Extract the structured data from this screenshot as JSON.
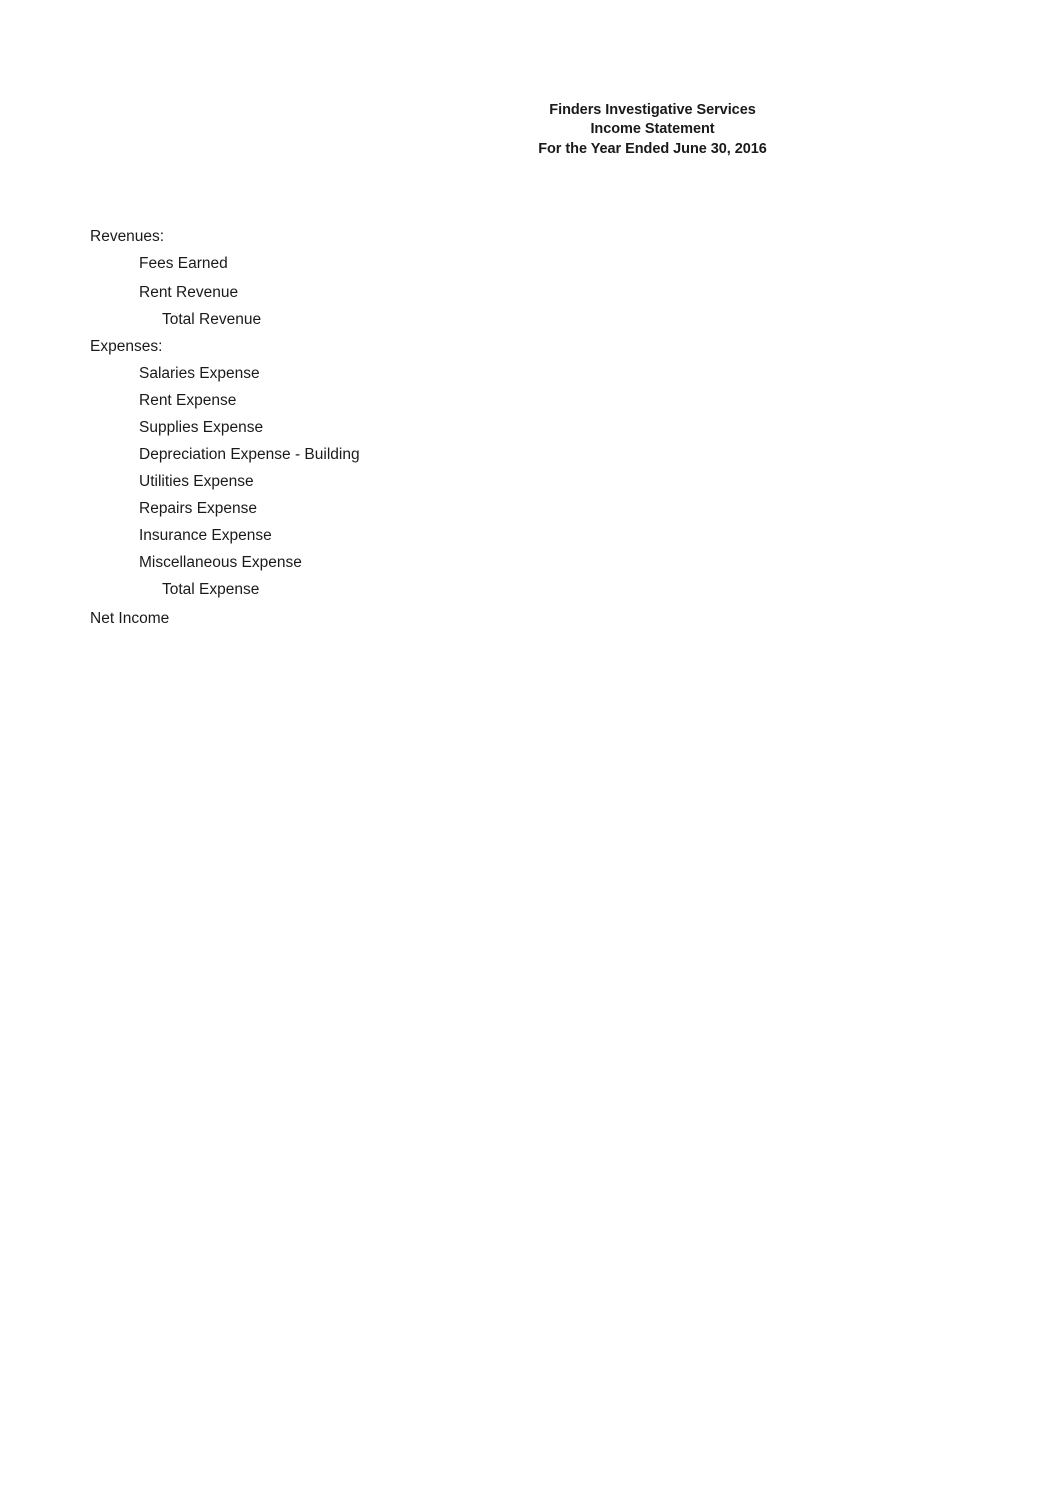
{
  "document": {
    "type": "income-statement-worksheet",
    "background_color": "#ffffff",
    "text_color": "#1a1a1a"
  },
  "header": {
    "company_name": "Finders Investigative Services",
    "statement_title": "Income Statement",
    "period": "For the Year Ended June 30, 2016"
  },
  "body": {
    "rows": [
      {
        "label": "Revenues:",
        "indent": 0,
        "spacing": "normal"
      },
      {
        "label": "Fees Earned",
        "indent": 1,
        "spacing": "large"
      },
      {
        "label": "Rent Revenue",
        "indent": 1,
        "spacing": "normal"
      },
      {
        "label": "Total Revenue",
        "indent": 2,
        "spacing": "normal"
      },
      {
        "label": "Expenses:",
        "indent": 0,
        "spacing": "normal"
      },
      {
        "label": "Salaries Expense",
        "indent": 1,
        "spacing": "normal"
      },
      {
        "label": "Rent Expense",
        "indent": 1,
        "spacing": "normal"
      },
      {
        "label": "Supplies Expense",
        "indent": 1,
        "spacing": "normal"
      },
      {
        "label": "Depreciation Expense - Building",
        "indent": 1,
        "spacing": "normal"
      },
      {
        "label": "Utilities Expense",
        "indent": 1,
        "spacing": "normal"
      },
      {
        "label": "Repairs Expense",
        "indent": 1,
        "spacing": "normal"
      },
      {
        "label": "Insurance Expense",
        "indent": 1,
        "spacing": "normal"
      },
      {
        "label": "Miscellaneous Expense",
        "indent": 1,
        "spacing": "normal"
      },
      {
        "label": "Total Expense",
        "indent": 2,
        "spacing": "xlarge"
      },
      {
        "label": "Net Income",
        "indent": 0,
        "spacing": "normal"
      }
    ]
  },
  "amounts": {
    "note": "no amount values are filled in on this worksheet"
  }
}
